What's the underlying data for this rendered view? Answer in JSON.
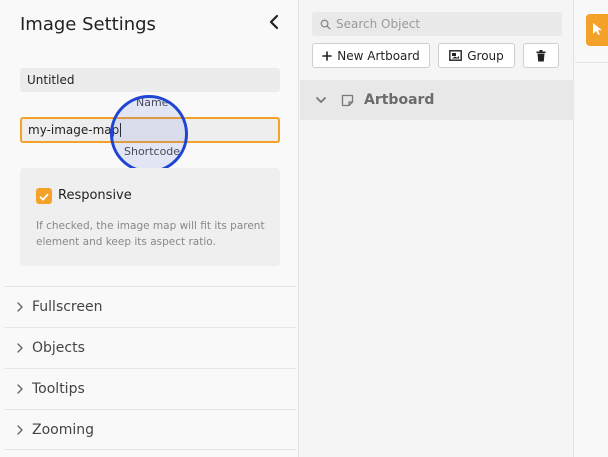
{
  "settings_panel": {
    "title": "Image Settings",
    "collapse_icon": "chevron-left-icon",
    "name_value": "Untitled",
    "name_label": "Name",
    "shortcode_value": "my-image-map",
    "shortcode_label": "Shortcode",
    "responsive": {
      "label": "Responsive",
      "checked": true,
      "help": "If checked, the image map will fit its parent element and keep its aspect ratio."
    },
    "sections": [
      {
        "label": "Fullscreen"
      },
      {
        "label": "Objects"
      },
      {
        "label": "Tooltips"
      },
      {
        "label": "Zooming"
      }
    ]
  },
  "objects_panel": {
    "search_placeholder": "Search Object",
    "new_artboard_label": "New Artboard",
    "group_label": "Group",
    "delete_icon": "trash-icon",
    "artboard_label": "Artboard"
  },
  "toolbar": {
    "select_tool_icon": "cursor-arrow-icon"
  },
  "colors": {
    "accent": "#f4a12a",
    "focus_ring": "#1f45d3"
  }
}
